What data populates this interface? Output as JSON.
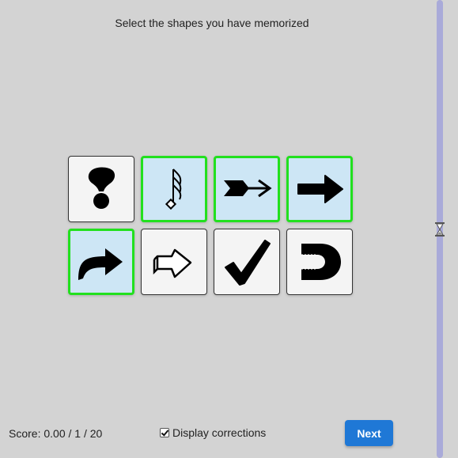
{
  "instruction": "Select the shapes you have memorized",
  "cards": [
    {
      "shape": "exclamation-blob-icon",
      "selected": false
    },
    {
      "shape": "music-note-icon",
      "selected": true
    },
    {
      "shape": "feathered-arrow-icon",
      "selected": true
    },
    {
      "shape": "bold-right-arrow-icon",
      "selected": true
    },
    {
      "shape": "curved-arrow-icon",
      "selected": true
    },
    {
      "shape": "outline-arrow-icon",
      "selected": false
    },
    {
      "shape": "checkmark-icon",
      "selected": false
    },
    {
      "shape": "cut-circle-arrow-icon",
      "selected": false
    }
  ],
  "score_text": "Score: 0.00 / 1 / 20",
  "display_corrections_label": "Display corrections",
  "display_corrections_checked": true,
  "next_label": "Next",
  "colors": {
    "background": "#d3d3d3",
    "selected_border": "#22e01e",
    "selected_fill": "#cde6f5",
    "timer_track": "#a9aad9",
    "next_button": "#1f78d6"
  },
  "timer_icon": "hourglass-icon"
}
